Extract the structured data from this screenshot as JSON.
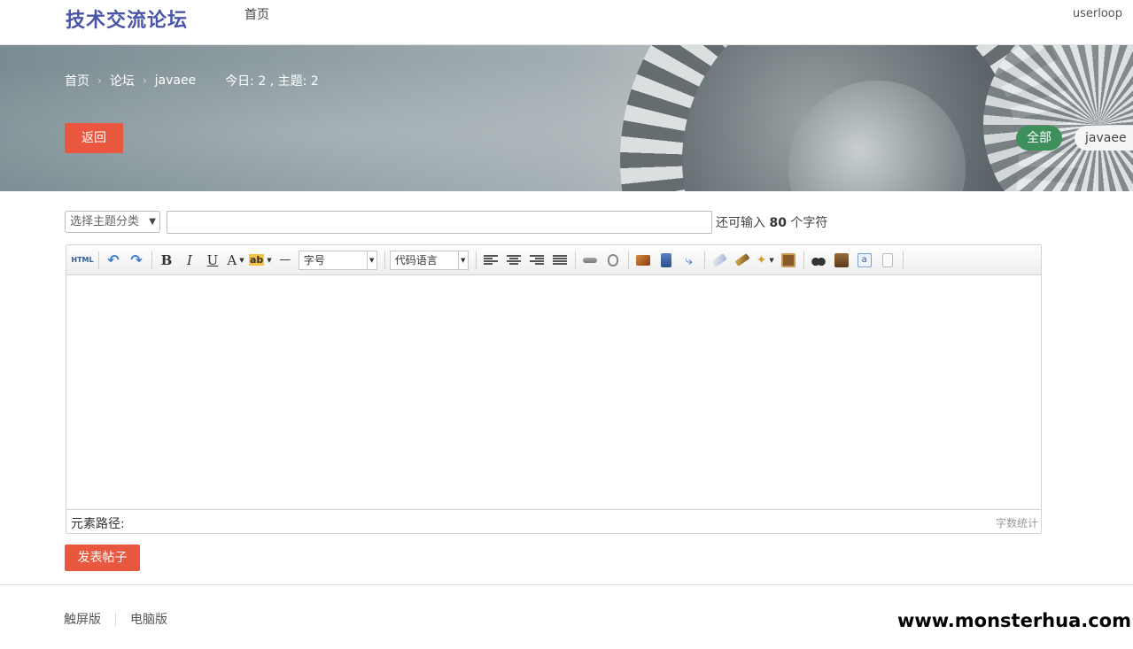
{
  "header": {
    "brand": "技术交流论坛",
    "nav_home": "首页",
    "username": "userloop"
  },
  "banner": {
    "breadcrumb": [
      "首页",
      "论坛",
      "javaee"
    ],
    "separator": "›",
    "stats": "今日: 2 , 主题: 2",
    "back_label": "返回",
    "tags": [
      "全部",
      "javaee"
    ]
  },
  "form": {
    "category_placeholder": "选择主题分类",
    "title_value": "",
    "char_hint_prefix": "还可输入",
    "char_hint_count": "80",
    "char_hint_suffix": "个字符"
  },
  "editor": {
    "toolbar": {
      "html_label": "HTML",
      "bold": "B",
      "italic": "I",
      "underline": "U",
      "font_color": "A",
      "highlight": "ab",
      "hr": "—",
      "font_size_label": "字号",
      "code_language_label": "代码语言"
    },
    "status_label": "元素路径:",
    "word_count_label": "字数统计"
  },
  "submit_label": "发表帖子",
  "footer": {
    "links": [
      "触屏版",
      "电脑版"
    ],
    "watermark": "www.monsterhua.com"
  },
  "colors": {
    "accent_red": "#e9573f",
    "brand_blue": "#4a55a8",
    "tag_green": "#3d8f5c"
  }
}
